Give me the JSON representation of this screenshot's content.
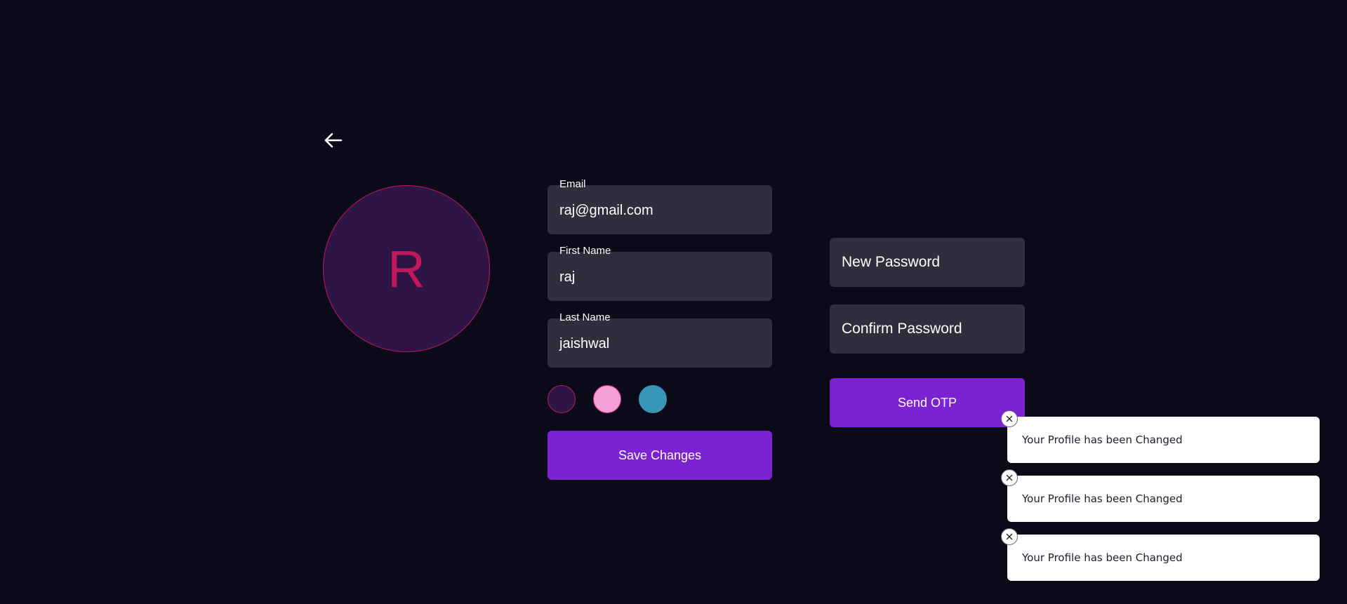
{
  "navigation": {
    "back_icon": "arrow-left-icon"
  },
  "avatar": {
    "initial": "R",
    "border_color": "#c2185b",
    "background_color": "#2f1546"
  },
  "profile_form": {
    "email": {
      "label": "Email",
      "value": "raj@gmail.com"
    },
    "first_name": {
      "label": "First Name",
      "value": "raj"
    },
    "last_name": {
      "label": "Last Name",
      "value": "jaishwal"
    },
    "theme_colors": [
      {
        "name": "purple",
        "fill": "#2f1546",
        "border": "#c2185b"
      },
      {
        "name": "pink",
        "fill": "#f4a0d7",
        "border": "#e0338f"
      },
      {
        "name": "teal",
        "fill": "#3a96b8",
        "border": "#3a96b8"
      }
    ],
    "save_label": "Save Changes"
  },
  "password_form": {
    "new_password_placeholder": "New Password",
    "confirm_password_placeholder": "Confirm Password",
    "send_otp_label": "Send OTP"
  },
  "toasts": [
    {
      "message": "Your Profile has been Changed",
      "close_icon": "close-icon"
    },
    {
      "message": "Your Profile has been Changed",
      "close_icon": "close-icon"
    },
    {
      "message": "Your Profile has been Changed",
      "close_icon": "close-icon"
    }
  ],
  "colors": {
    "background": "#0b0a19",
    "field_background": "#2e2e3c",
    "accent": "#7b22d3",
    "toast_background": "#ffffff"
  }
}
